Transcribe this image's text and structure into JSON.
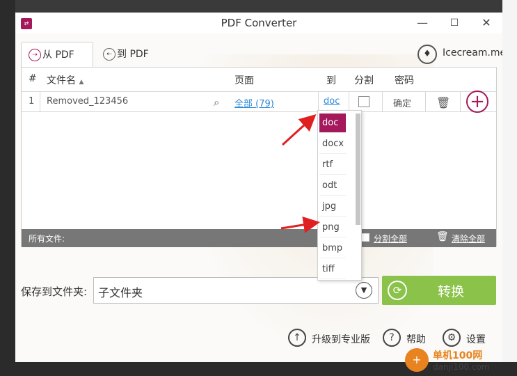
{
  "window": {
    "title": "PDF Converter",
    "app_icon": "pdf-app-icon"
  },
  "titlebar_controls": {
    "minimize": "—",
    "maximize": "☐",
    "close": "✕"
  },
  "tabs": [
    {
      "label": "从 PDF",
      "icon": "from-pdf-icon",
      "active": true
    },
    {
      "label": "到 PDF",
      "icon": "to-pdf-icon",
      "active": false
    }
  ],
  "brand": {
    "name": "Icecream.me",
    "icon": "icecream-logo-icon"
  },
  "table": {
    "headers": {
      "num": "#",
      "filename": "文件名",
      "pages": "页面",
      "to": "到",
      "split": "分割",
      "password": "密码"
    },
    "rows": [
      {
        "num": "1",
        "filename": "Removed_123456",
        "pages": "全部 (79)",
        "to": "doc",
        "split_checked": false,
        "password": "确定"
      }
    ],
    "status": {
      "all_files": "所有文件:",
      "split_all": "分割全部",
      "clear_all": "清除全部"
    }
  },
  "format_dropdown": {
    "options": [
      "doc",
      "docx",
      "rtf",
      "odt",
      "jpg",
      "png",
      "bmp",
      "tiff"
    ],
    "selected": "doc"
  },
  "save": {
    "label": "保存到文件夹:",
    "value": "子文件夹"
  },
  "convert": {
    "label": "转换",
    "color": "#8bc34a"
  },
  "footer": {
    "upgrade": "升级到专业版",
    "help": "帮助",
    "settings": "设置"
  },
  "watermark": {
    "site_cn": "单机100网",
    "site_url": "danji100.com"
  },
  "colors": {
    "accent": "#a3195b",
    "link": "#2d8ad6",
    "annotation_arrow": "#e02020"
  }
}
